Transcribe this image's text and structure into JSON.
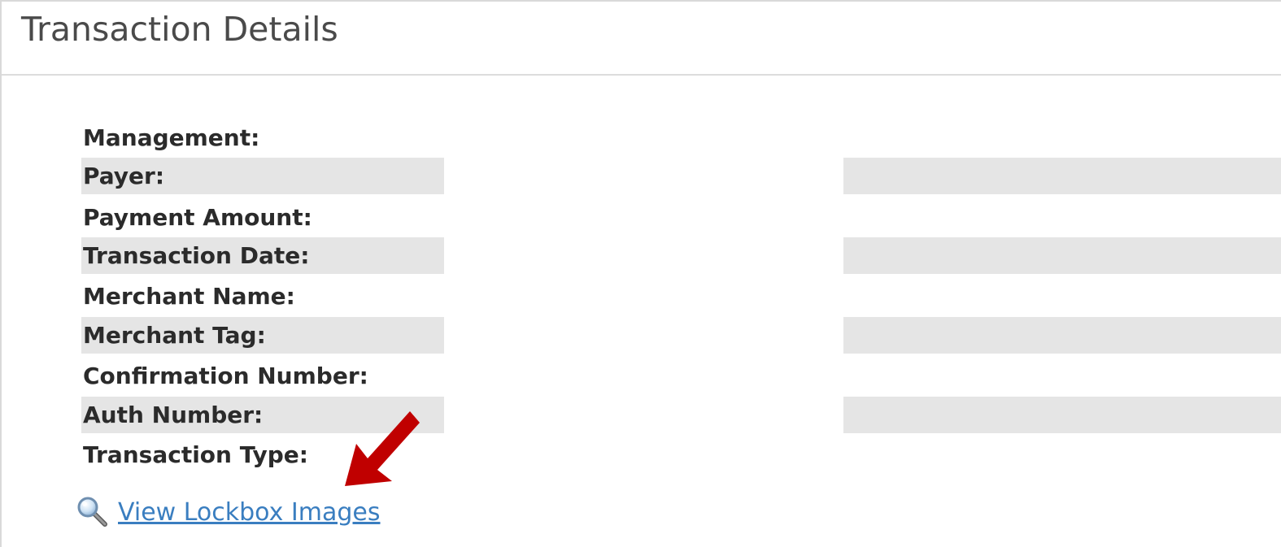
{
  "panel": {
    "title": "Transaction Details"
  },
  "fields": [
    {
      "label": "Management:",
      "value": ""
    },
    {
      "label": "Payer:",
      "value": ""
    },
    {
      "label": "Payment Amount:",
      "value": ""
    },
    {
      "label": "Transaction Date:",
      "value": ""
    },
    {
      "label": "Merchant Name:",
      "value": ""
    },
    {
      "label": "Merchant Tag:",
      "value": ""
    },
    {
      "label": "Confirmation Number:",
      "value": ""
    },
    {
      "label": "Auth Number:",
      "value": ""
    },
    {
      "label": "Transaction Type:",
      "value": ""
    }
  ],
  "lockbox_link": {
    "label": "View Lockbox Images",
    "icon": "magnifier-icon"
  },
  "annotation": {
    "icon": "red-arrow-icon",
    "color": "#c00000"
  },
  "colors": {
    "link": "#3a7ec0",
    "row_shade": "#e5e5e5",
    "title": "#4a4a4a"
  }
}
